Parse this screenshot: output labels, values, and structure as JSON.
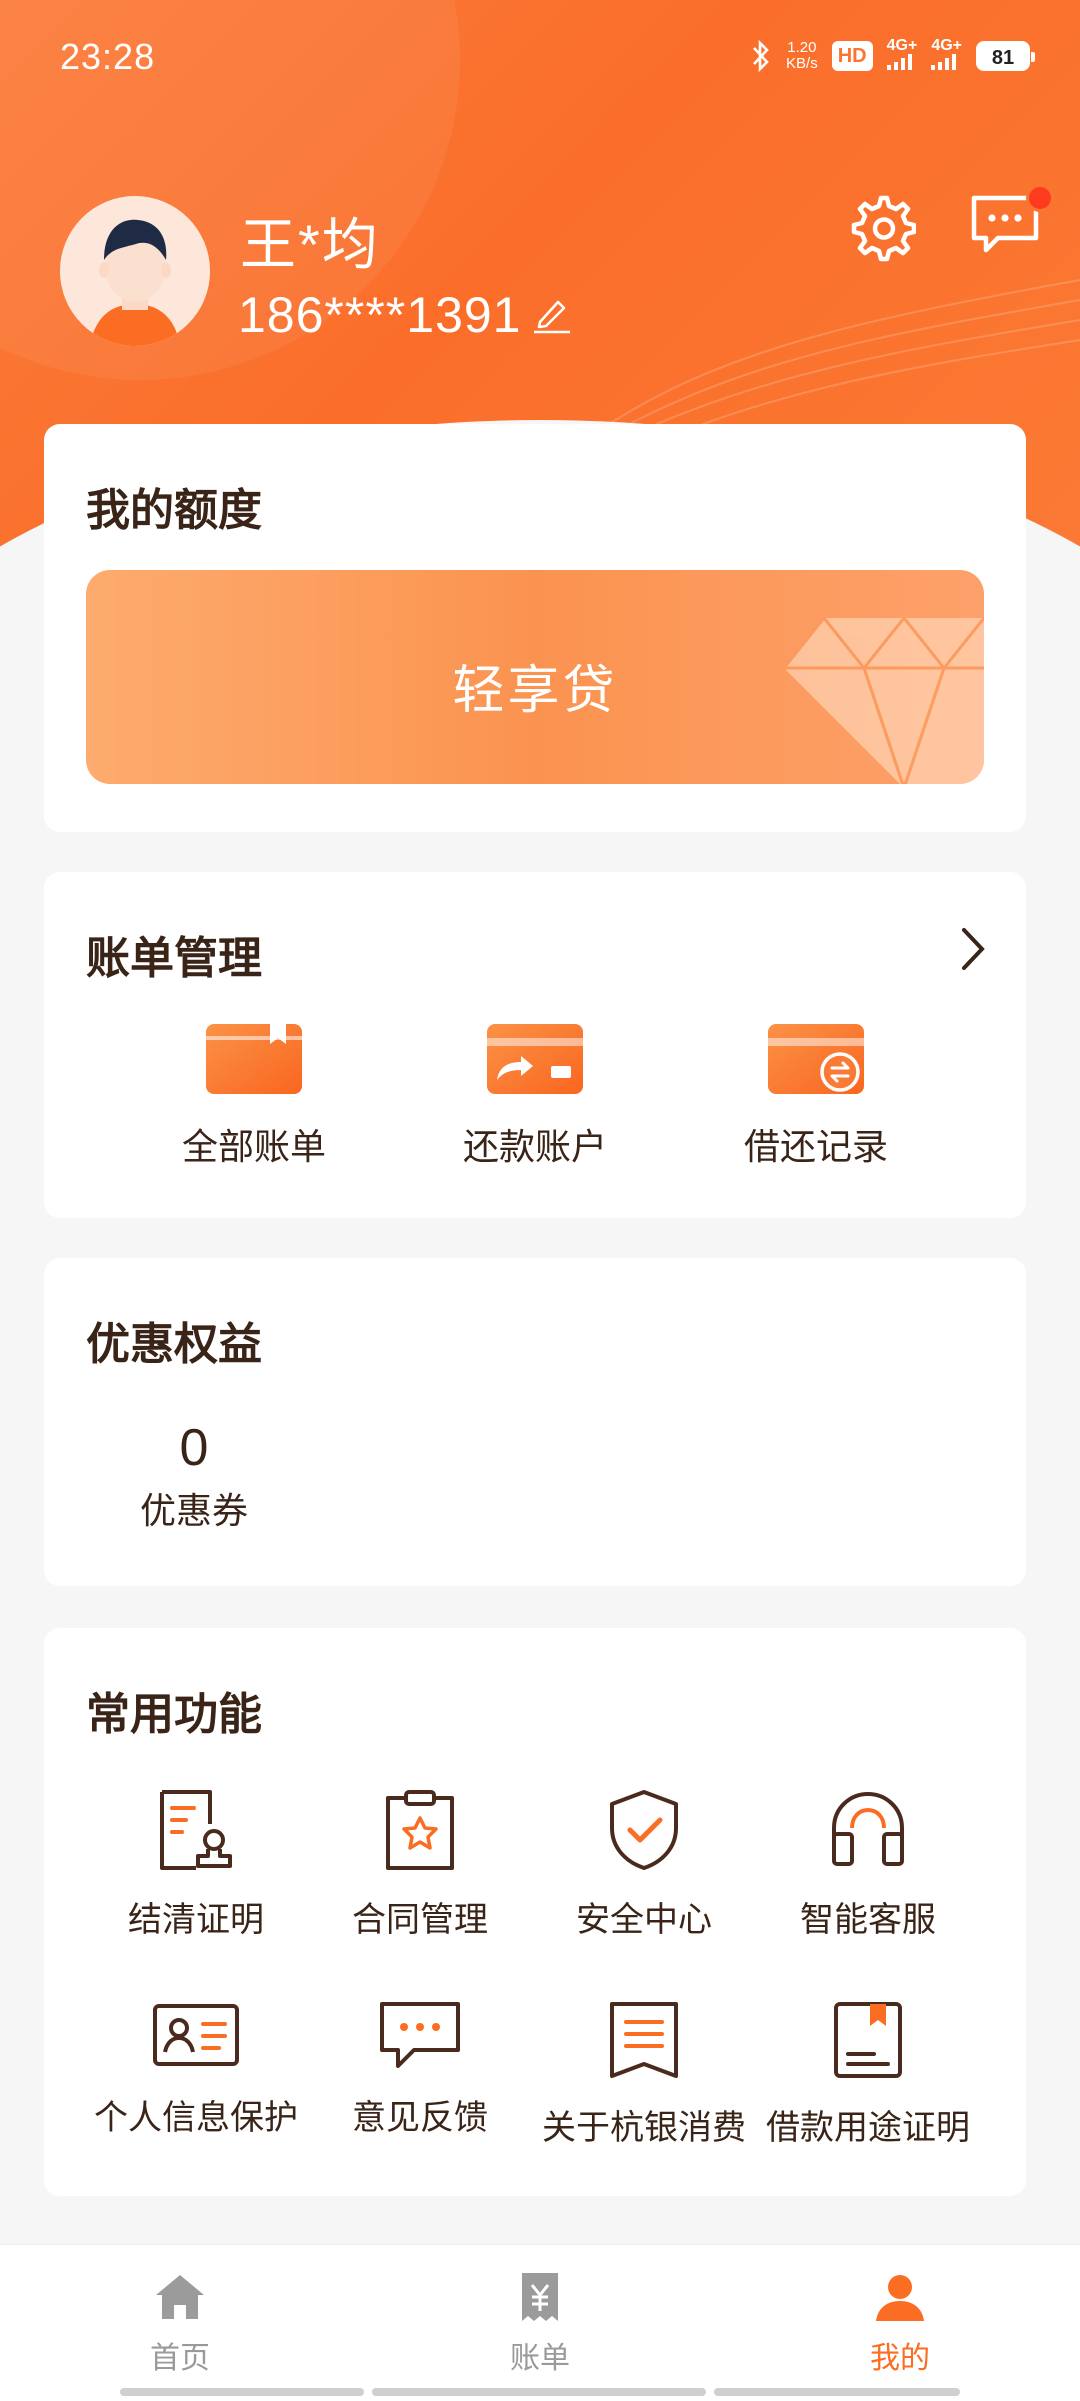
{
  "status_bar": {
    "time": "23:28",
    "net_speed": "1.20",
    "net_unit": "KB/s",
    "hd": "HD",
    "signal1": "4G+",
    "signal2": "4G+",
    "battery": "81"
  },
  "profile": {
    "name": "王*均",
    "phone": "186****1391"
  },
  "credit": {
    "title": "我的额度",
    "product": "轻享贷"
  },
  "bills": {
    "title": "账单管理",
    "items": [
      {
        "label": "全部账单"
      },
      {
        "label": "还款账户"
      },
      {
        "label": "借还记录"
      }
    ]
  },
  "benefits": {
    "title": "优惠权益",
    "coupon_count": "0",
    "coupon_label": "优惠券"
  },
  "functions": {
    "title": "常用功能",
    "items": [
      {
        "label": "结清证明",
        "icon": "settlement-certificate-icon"
      },
      {
        "label": "合同管理",
        "icon": "contract-icon"
      },
      {
        "label": "安全中心",
        "icon": "shield-icon"
      },
      {
        "label": "智能客服",
        "icon": "headset-icon"
      },
      {
        "label": "个人信息保护",
        "icon": "id-card-icon"
      },
      {
        "label": "意见反馈",
        "icon": "chat-bubble-icon"
      },
      {
        "label": "关于杭银消费",
        "icon": "book-icon"
      },
      {
        "label": "借款用途证明",
        "icon": "bookmark-doc-icon"
      }
    ]
  },
  "tabs": [
    {
      "label": "首页",
      "icon": "home-icon"
    },
    {
      "label": "账单",
      "icon": "bill-icon"
    },
    {
      "label": "我的",
      "icon": "person-icon",
      "active": true
    }
  ],
  "colors": {
    "brand": "#fb6d22",
    "text": "#3a2418",
    "icon_stroke": "#4a2a1c"
  }
}
